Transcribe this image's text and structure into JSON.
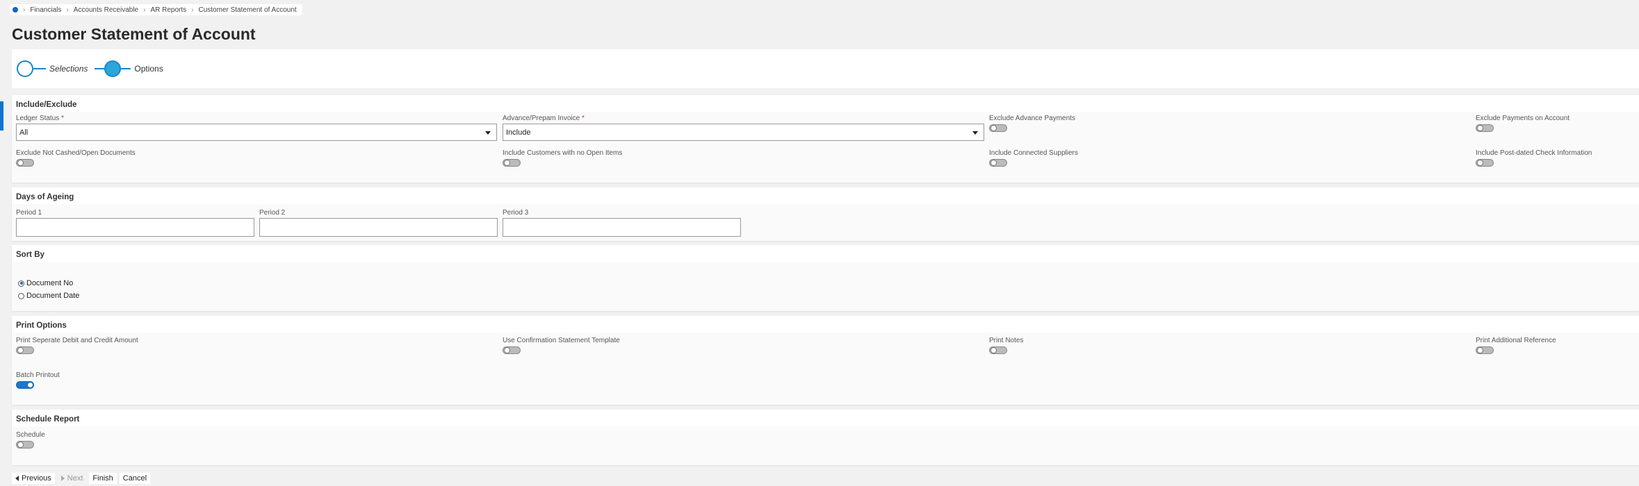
{
  "breadcrumb": {
    "items": [
      "Financials",
      "Accounts Receivable",
      "AR Reports",
      "Customer Statement of Account"
    ]
  },
  "page_title": "Customer Statement of Account",
  "stepper": {
    "steps": [
      {
        "label": "Selections",
        "state": "completed"
      },
      {
        "label": "Options",
        "state": "active"
      }
    ]
  },
  "include_exclude": {
    "title": "Include/Exclude",
    "ledger_status": {
      "label": "Ledger Status",
      "value": "All",
      "required_mark": "*"
    },
    "advance_prepam": {
      "label": "Advance/Prepam Invoice",
      "value": "Include",
      "required_mark": "*"
    },
    "toggles": [
      {
        "label": "Exclude Advance Payments",
        "on": false
      },
      {
        "label": "Exclude Payments on Account",
        "on": false
      },
      {
        "label": "Exclude Not Cashed/Open Documents",
        "on": false
      },
      {
        "label": "Include Customers with no Open Items",
        "on": false
      },
      {
        "label": "Include Connected Suppliers",
        "on": false
      },
      {
        "label": "Include Post-dated Check Information",
        "on": false
      }
    ]
  },
  "days_of_ageing": {
    "title": "Days of Ageing",
    "periods": [
      {
        "label": "Period 1",
        "value": ""
      },
      {
        "label": "Period 2",
        "value": ""
      },
      {
        "label": "Period 3",
        "value": ""
      }
    ]
  },
  "sort_by": {
    "title": "Sort By",
    "options": [
      {
        "label": "Document No",
        "checked": true
      },
      {
        "label": "Document Date",
        "checked": false
      }
    ]
  },
  "print_options": {
    "title": "Print Options",
    "toggles": [
      {
        "label": "Print Seperate Debit and Credit Amount",
        "on": false
      },
      {
        "label": "Use Confirmation Statement Template",
        "on": false
      },
      {
        "label": "Print Notes",
        "on": false
      },
      {
        "label": "Print Additional Reference",
        "on": false
      },
      {
        "label": "Batch Printout",
        "on": true
      }
    ]
  },
  "schedule_report": {
    "title": "Schedule Report",
    "schedule": {
      "label": "Schedule",
      "on": false
    }
  },
  "footer": {
    "previous": "Previous",
    "next": "Next",
    "finish": "Finish",
    "cancel": "Cancel"
  },
  "colors": {
    "accent": "#1976d2",
    "background": "#f1f1f2"
  }
}
